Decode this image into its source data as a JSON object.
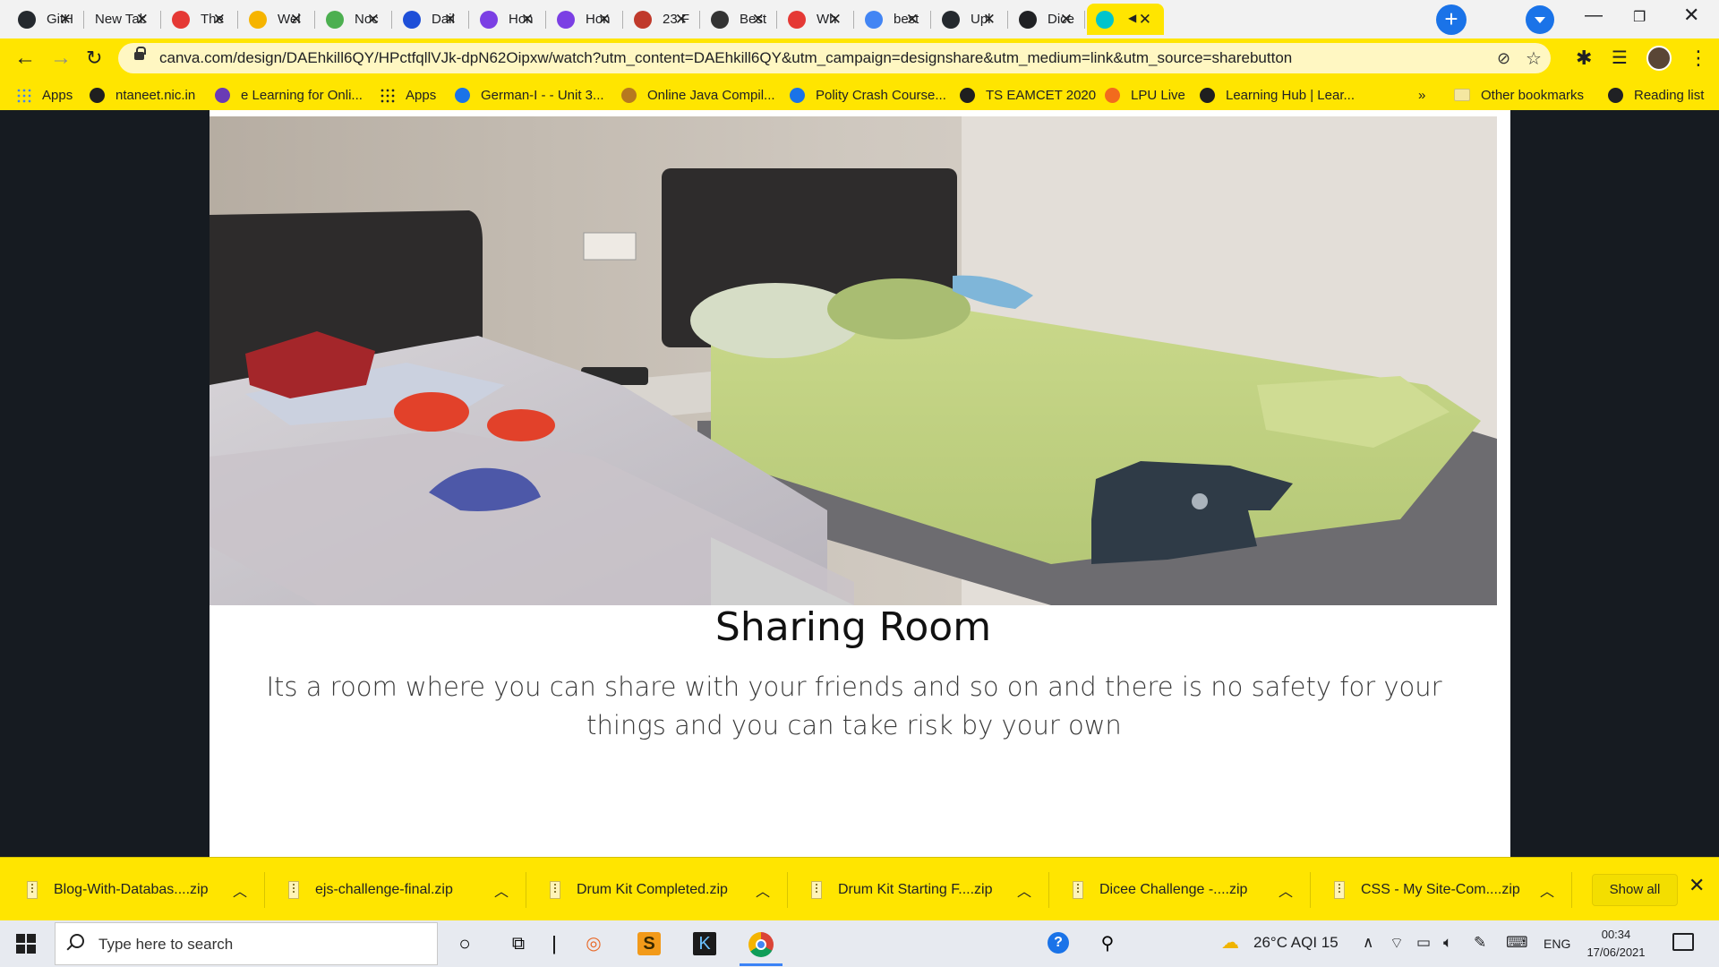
{
  "tabs": [
    {
      "label": "GitH",
      "icon": "github-icon",
      "color": "#24292e"
    },
    {
      "label": "New Tab",
      "icon": "",
      "color": ""
    },
    {
      "label": "The",
      "icon": "red-logo-icon",
      "color": "#e53935"
    },
    {
      "label": "Wel",
      "icon": "yellow-coin-icon",
      "color": "#f6b400"
    },
    {
      "label": "Noc",
      "icon": "green-leaf-icon",
      "color": "#4caf50"
    },
    {
      "label": "Dail",
      "icon": "ui-logo-icon",
      "color": "#1e4fd8"
    },
    {
      "label": "Hon",
      "icon": "canva-icon",
      "color": "#7b3fe4"
    },
    {
      "label": "Hon",
      "icon": "canva-icon",
      "color": "#7b3fe4"
    },
    {
      "label": "23 F",
      "icon": "calendar-icon",
      "color": "#c0392b"
    },
    {
      "label": "Best",
      "icon": "quora-icon",
      "color": "#333333"
    },
    {
      "label": "Wh",
      "icon": "alert-icon",
      "color": "#e53935"
    },
    {
      "label": "best",
      "icon": "google-icon",
      "color": "#4285f4"
    },
    {
      "label": "Upl",
      "icon": "github-icon",
      "color": "#24292e"
    },
    {
      "label": "Dice",
      "icon": "globe-icon",
      "color": "#202124"
    },
    {
      "label": "",
      "icon": "canva-icon",
      "color": "#00c4cc",
      "active": true
    }
  ],
  "address": {
    "url": "canva.com/design/DAEhkill6QY/HPctfqllVJk-dpN62Oipxw/watch?utm_content=DAEhkill6QY&utm_campaign=designshare&utm_medium=link&utm_source=sharebutton"
  },
  "bookmarks": [
    {
      "label": "Apps",
      "icon": "apps-grid-icon"
    },
    {
      "label": "ntaneet.nic.in",
      "icon": "globe-icon"
    },
    {
      "label": "e Learning for Onli...",
      "icon": "purple-b-icon"
    },
    {
      "label": "Apps",
      "icon": "apps-grid-icon"
    },
    {
      "label": "German-I - - Unit 3...",
      "icon": "s-logo-icon"
    },
    {
      "label": "Online Java Compil...",
      "icon": "java-icon"
    },
    {
      "label": "Polity Crash Course...",
      "icon": "shield-icon"
    },
    {
      "label": "TS EAMCET 2020",
      "icon": "globe-icon"
    },
    {
      "label": "LPU Live",
      "icon": "lpu-icon"
    },
    {
      "label": "Learning Hub | Lear...",
      "icon": "globe-icon"
    },
    {
      "label": "»",
      "icon": ""
    },
    {
      "label": "Other bookmarks",
      "icon": "folder-icon"
    },
    {
      "label": "Reading list",
      "icon": "reading-list-icon"
    }
  ],
  "page": {
    "title": "Sharing Room",
    "description": "Its a  room where you can share with your friends and so  on and there is no safety for your things and you can take risk by your own"
  },
  "downloads": [
    {
      "name": "Blog-With-Databas....zip"
    },
    {
      "name": "ejs-challenge-final.zip"
    },
    {
      "name": "Drum Kit Completed.zip"
    },
    {
      "name": "Drum Kit Starting F....zip"
    },
    {
      "name": "Dicee Challenge -....zip"
    },
    {
      "name": "CSS - My Site-Com....zip"
    }
  ],
  "show_all": "Show all",
  "taskbar": {
    "search_placeholder": "Type here to search",
    "weather": "26°C  AQI 15",
    "lang": "ENG",
    "time": "00:34",
    "date": "17/06/2021"
  },
  "colors": {
    "theme_yellow": "#ffe500",
    "page_bg": "#161b21",
    "card_bg": "#ffffff"
  }
}
